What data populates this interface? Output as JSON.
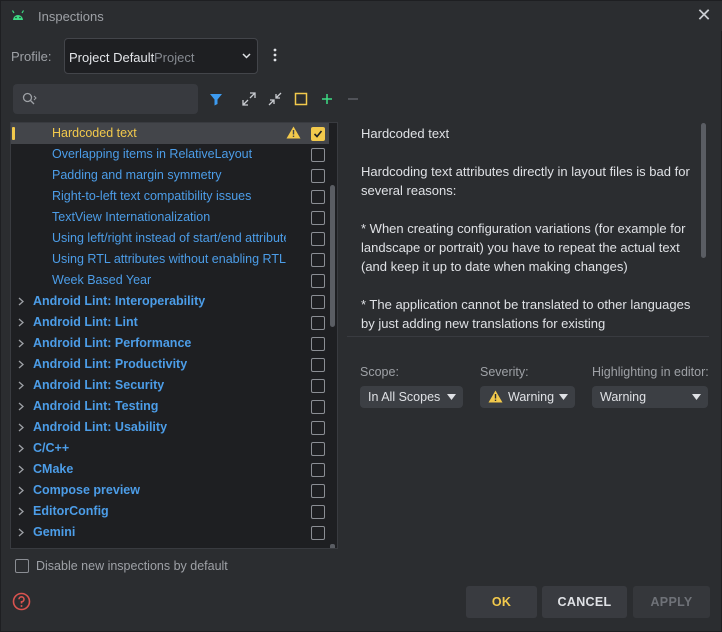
{
  "window": {
    "title": "Inspections"
  },
  "profile": {
    "label": "Profile:",
    "value": "Project Default",
    "scope": "Project"
  },
  "search": {
    "value": "",
    "placeholder": ""
  },
  "toolbar": {
    "icons": [
      "filter-icon",
      "expand-all-icon",
      "collapse-all-icon",
      "reset-square-icon",
      "add-icon",
      "remove-icon"
    ],
    "filter_color": "#3d9bf0",
    "accent": "#f2c94c"
  },
  "tree": {
    "items": [
      {
        "label": "Hardcoded text",
        "type": "child",
        "checked": true,
        "warning": true,
        "selected": true
      },
      {
        "label": "Overlapping items in RelativeLayout",
        "type": "child",
        "checked": false
      },
      {
        "label": "Padding and margin symmetry",
        "type": "child",
        "checked": false
      },
      {
        "label": "Right-to-left text compatibility issues",
        "type": "child",
        "checked": false
      },
      {
        "label": "TextView Internationalization",
        "type": "child",
        "checked": false
      },
      {
        "label": "Using left/right instead of start/end attributes",
        "type": "child",
        "checked": false
      },
      {
        "label": "Using RTL attributes without enabling RTL support",
        "type": "child",
        "checked": false
      },
      {
        "label": "Week Based Year",
        "type": "child",
        "checked": false
      },
      {
        "label": "Android Lint: Interoperability",
        "type": "group",
        "checked": false
      },
      {
        "label": "Android Lint: Lint",
        "type": "group",
        "checked": false
      },
      {
        "label": "Android Lint: Performance",
        "type": "group",
        "checked": false
      },
      {
        "label": "Android Lint: Productivity",
        "type": "group",
        "checked": false
      },
      {
        "label": "Android Lint: Security",
        "type": "group",
        "checked": false
      },
      {
        "label": "Android Lint: Testing",
        "type": "group",
        "checked": false
      },
      {
        "label": "Android Lint: Usability",
        "type": "group",
        "checked": false
      },
      {
        "label": "C/C++",
        "type": "group",
        "checked": false
      },
      {
        "label": "CMake",
        "type": "group",
        "checked": false
      },
      {
        "label": "Compose preview",
        "type": "group",
        "checked": false
      },
      {
        "label": "EditorConfig",
        "type": "group",
        "checked": false
      },
      {
        "label": "Gemini",
        "type": "group",
        "checked": false
      }
    ]
  },
  "description": {
    "title": "Hardcoded text",
    "paragraphs": [
      "Hardcoding text attributes directly in layout files is bad for several reasons:",
      "* When creating configuration variations (for example for landscape or portrait) you have to repeat the actual text (and keep it up to date when making changes)",
      "* The application cannot be translated to other languages by just adding new translations for existing"
    ]
  },
  "options": {
    "scope": {
      "label": "Scope:",
      "value": "In All Scopes"
    },
    "severity": {
      "label": "Severity:",
      "value": "Warning"
    },
    "highlighting": {
      "label": "Highlighting in editor:",
      "value": "Warning"
    }
  },
  "footer": {
    "disable_label": "Disable new inspections by default",
    "disable_checked": false,
    "ok": "OK",
    "cancel": "CANCEL",
    "apply": "APPLY"
  }
}
